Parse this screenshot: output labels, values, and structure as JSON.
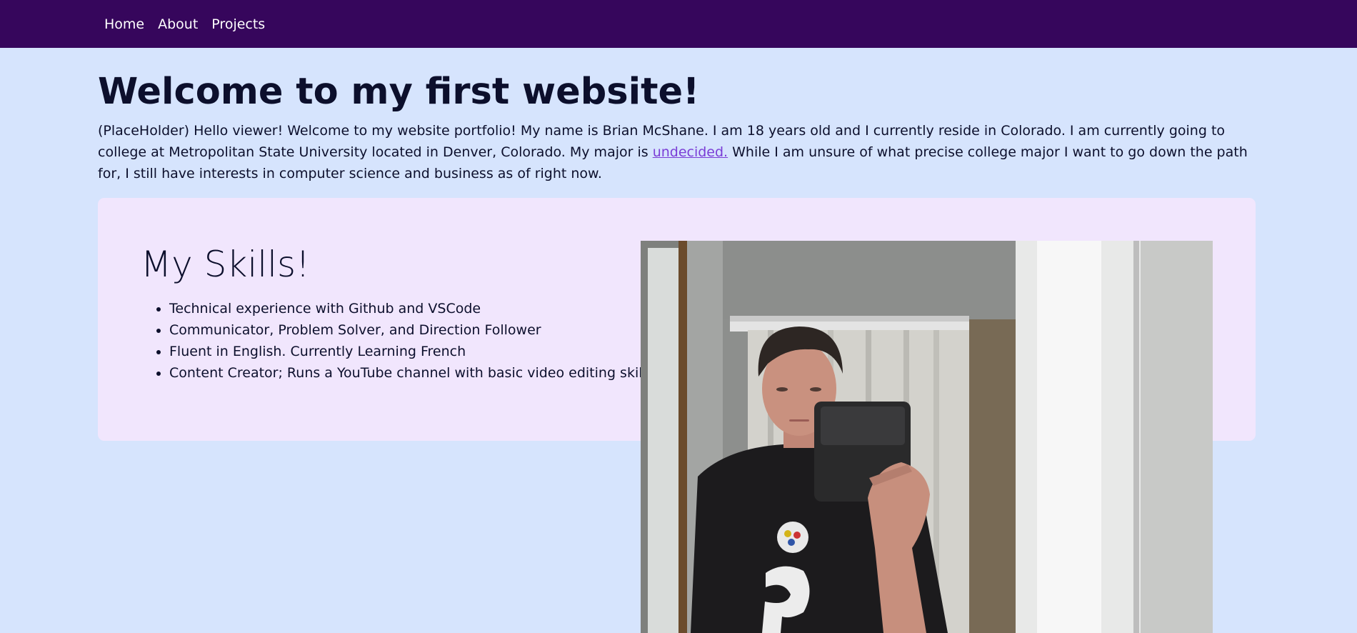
{
  "nav": {
    "items": [
      {
        "label": "Home"
      },
      {
        "label": "About"
      },
      {
        "label": "Projects"
      }
    ]
  },
  "main": {
    "title": "Welcome to my first website!",
    "intro": {
      "text_before": "(PlaceHolder) Hello viewer! Welcome to my website portfolio! My name is Brian McShane. I am 18 years old and I currently reside in Colorado. I am currently going to college at Metropolitan State University located in Denver, Colorado. My major is ",
      "link_text": "undecided.",
      "text_after": " While I am unsure of what precise college major I want to go down the path for, I still have interests in computer science and business as of right now."
    }
  },
  "skills": {
    "title": "My Skills!",
    "items": [
      "Technical experience with Github and VSCode",
      "Communicator, Problem Solver, and Direction Follower",
      "Fluent in English. Currently Learning French",
      "Content Creator; Runs a YouTube channel with basic video editing skills"
    ]
  },
  "photo": {
    "subject": "mirror selfie photo"
  },
  "colors": {
    "navbar": "#36065c",
    "page_background": "#d6e4fd",
    "card_background": "#f1e6fd",
    "link": "#7a3dd6",
    "text": "#0c0f2c"
  }
}
